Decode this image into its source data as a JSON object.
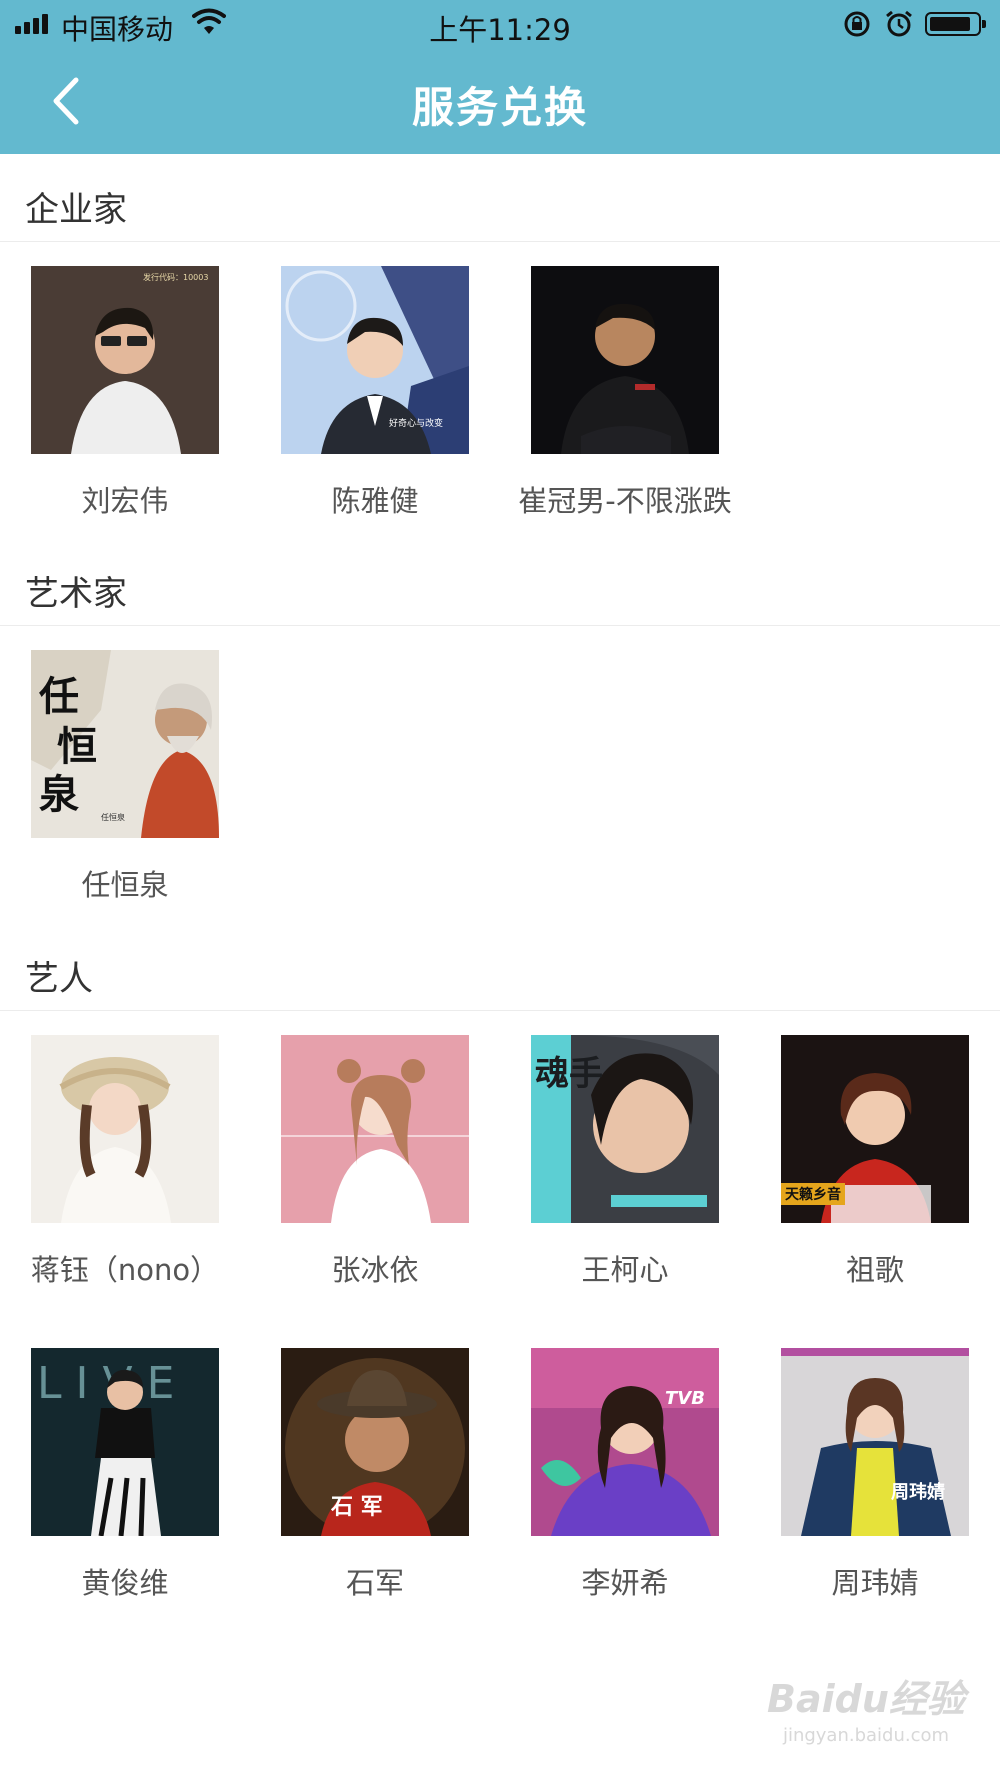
{
  "status_bar": {
    "carrier": "中国移动",
    "time": "上午11:29"
  },
  "nav": {
    "title": "服务兑换"
  },
  "sections": [
    {
      "title": "企业家",
      "items": [
        {
          "name": "刘宏伟",
          "overlay": "发行代码：10003"
        },
        {
          "name": "陈雅健",
          "overlay": "好奇心与改变"
        },
        {
          "name": "崔冠男-不限涨跌"
        }
      ]
    },
    {
      "title": "艺术家",
      "items": [
        {
          "name": "任恒泉",
          "overlay": "任恒泉"
        }
      ]
    },
    {
      "title": "艺人",
      "items": [
        {
          "name": "蒋钰（nono）"
        },
        {
          "name": "张冰依"
        },
        {
          "name": "王柯心",
          "overlay": "魂手"
        },
        {
          "name": "祖歌",
          "overlay": "天籁乡音"
        },
        {
          "name": "黄俊维",
          "overlay": "LIVE"
        },
        {
          "name": "石军",
          "overlay": "石 军"
        },
        {
          "name": "李妍希",
          "overlay": "TVB"
        },
        {
          "name": "周玮婧",
          "overlay": "周玮婧"
        }
      ]
    }
  ],
  "watermark": {
    "logo": "Baidu经验",
    "url": "jingyan.baidu.com"
  },
  "colors": {
    "header": "#63b9cf",
    "section_text": "#333333",
    "name_text": "#555555"
  }
}
